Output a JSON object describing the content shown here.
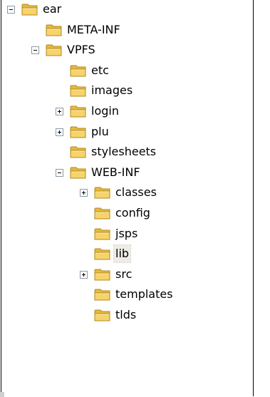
{
  "tree": {
    "nodes": [
      {
        "label": "ear",
        "depth": 0,
        "expander": "expanded",
        "selected": false
      },
      {
        "label": "META-INF",
        "depth": 1,
        "expander": "none",
        "selected": false
      },
      {
        "label": "VPFS",
        "depth": 1,
        "expander": "expanded",
        "selected": false
      },
      {
        "label": "etc",
        "depth": 2,
        "expander": "none",
        "selected": false
      },
      {
        "label": "images",
        "depth": 2,
        "expander": "none",
        "selected": false
      },
      {
        "label": "login",
        "depth": 2,
        "expander": "collapsed",
        "selected": false
      },
      {
        "label": "plu",
        "depth": 2,
        "expander": "collapsed",
        "selected": false
      },
      {
        "label": "stylesheets",
        "depth": 2,
        "expander": "none",
        "selected": false
      },
      {
        "label": "WEB-INF",
        "depth": 2,
        "expander": "expanded",
        "selected": false
      },
      {
        "label": "classes",
        "depth": 3,
        "expander": "collapsed",
        "selected": false
      },
      {
        "label": "config",
        "depth": 3,
        "expander": "none",
        "selected": false
      },
      {
        "label": "jsps",
        "depth": 3,
        "expander": "none",
        "selected": false
      },
      {
        "label": "lib",
        "depth": 3,
        "expander": "none",
        "selected": true
      },
      {
        "label": "src",
        "depth": 3,
        "expander": "collapsed",
        "selected": false
      },
      {
        "label": "templates",
        "depth": 3,
        "expander": "none",
        "selected": false
      },
      {
        "label": "tlds",
        "depth": 3,
        "expander": "none",
        "selected": false
      }
    ]
  },
  "icons": {
    "folder": "folder-icon",
    "expand": "plus-box-icon",
    "collapse": "minus-box-icon"
  },
  "colors": {
    "folder_fill": "#f6d36b",
    "folder_back": "#e8b83d",
    "folder_stroke": "#b08a1e",
    "selection_bg": "#efece6"
  }
}
